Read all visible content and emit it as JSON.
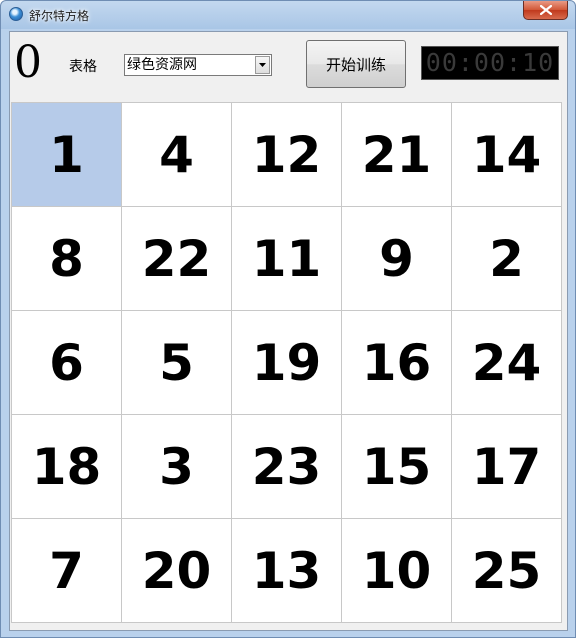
{
  "window": {
    "title": "舒尔特方格",
    "icons": {
      "app": "app-icon",
      "close": "close-icon"
    }
  },
  "toolbar": {
    "counter": "0",
    "table_label": "表格",
    "table_select_value": "绿色资源网",
    "start_button": "开始训练",
    "timer": "00:00:10"
  },
  "grid": {
    "selected_index": 0,
    "cells": [
      "1",
      "4",
      "12",
      "21",
      "14",
      "8",
      "22",
      "11",
      "9",
      "2",
      "6",
      "5",
      "19",
      "16",
      "24",
      "18",
      "3",
      "23",
      "15",
      "17",
      "7",
      "20",
      "13",
      "10",
      "25"
    ]
  },
  "colors": {
    "selected_cell": "#b6cbe9",
    "timer_bg": "#000000",
    "timer_text": "#3a3a3a"
  }
}
